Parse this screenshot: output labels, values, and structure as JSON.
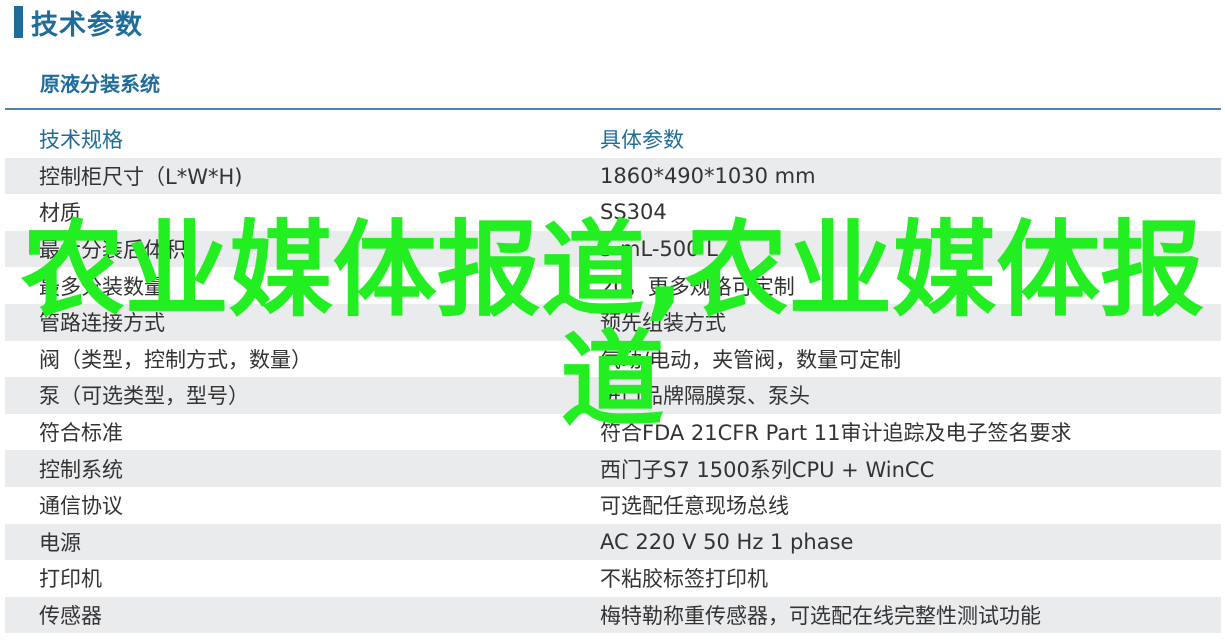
{
  "page": {
    "title": "技术参数",
    "section_title": "原液分装系统"
  },
  "table": {
    "header": {
      "key": "技术规格",
      "value": "具体参数"
    },
    "rows": [
      {
        "key": "控制柜尺寸（L*W*H)",
        "value": "1860*490*1030 mm"
      },
      {
        "key": "材质",
        "value": "SS304"
      },
      {
        "key": "最大分装后体积",
        "value": "5 mL-500 L"
      },
      {
        "key": "最多分装数量",
        "value": "20，更多规格可定制"
      },
      {
        "key": "管路连接方式",
        "value": "预先组装方式"
      },
      {
        "key": "阀（类型，控制方式，数量）",
        "value": "气动/电动，夹管阀，数量可定制"
      },
      {
        "key": "泵（可选类型，型号）",
        "value": "进口品牌隔膜泵、泵头"
      },
      {
        "key": "符合标准",
        "value": "符合FDA 21CFR Part 11审计追踪及电子签名要求"
      },
      {
        "key": "控制系统",
        "value": "西门子S7 1500系列CPU + WinCC"
      },
      {
        "key": "通信协议",
        "value": "可选配任意现场总线"
      },
      {
        "key": "电源",
        "value": "AC 220 V 50 Hz 1 phase"
      },
      {
        "key": "打印机",
        "value": "不粘胶标签打印机"
      },
      {
        "key": "传感器",
        "value": "梅特勒称重传感器，可选配在线完整性测试功能"
      }
    ]
  },
  "watermark": {
    "text": "农业媒体报道,农业媒体报道"
  },
  "colors": {
    "accent": "#1f6c9a",
    "rule": "#4b86b0",
    "shade": "#eaebed",
    "watermark": "#22ee22"
  }
}
